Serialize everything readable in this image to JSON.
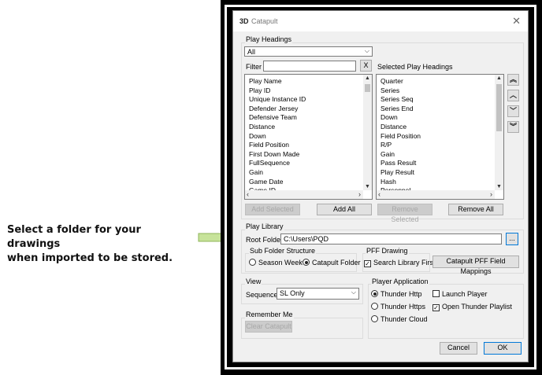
{
  "callout": {
    "line1": "Select a folder for your drawings",
    "line2": "when imported to be stored."
  },
  "dialog": {
    "title": "Catapult",
    "app_icon": "3D",
    "close_glyph": "✕"
  },
  "play_headings": {
    "group_label": "Play Headings",
    "combo_value": "All",
    "filter_label": "Filter",
    "filter_value": "",
    "filter_clear": "X",
    "selected_label": "Selected Play Headings",
    "available": [
      "Play Name",
      "Play ID",
      "Unique Instance ID",
      "Defender Jersey",
      "Defensive Team",
      "Distance",
      "Down",
      "Field Position",
      "First Down Made",
      "FullSequence",
      "Gain",
      "Game Date",
      "Game ID"
    ],
    "selected": [
      "Quarter",
      "Series",
      "Series Seq",
      "Series End",
      "Down",
      "Distance",
      "Field Position",
      "R/P",
      "Gain",
      "Pass Result",
      "Play Result",
      "Hash",
      "Personnel"
    ],
    "add_selected": "Add Selected",
    "add_all": "Add All",
    "remove_selected": "Remove Selected",
    "remove_all": "Remove All",
    "order_icons": [
      "double-up-icon",
      "up-icon",
      "down-icon",
      "double-down-icon"
    ]
  },
  "play_library": {
    "group_label": "Play Library",
    "root_folder_label": "Root Folder",
    "root_folder_value": "C:\\Users\\PQD",
    "browse_label": "...",
    "sub_folder": {
      "label": "Sub Folder Structure",
      "season_week": "Season Week",
      "catapult_folder": "Catapult Folder",
      "selected": "Catapult Folder"
    },
    "pff_drawing": {
      "label": "PFF Drawing",
      "search_library_first": "Search Library First",
      "search_library_first_checked": true,
      "mappings_button": "Catapult PFF Field Mappings"
    }
  },
  "view": {
    "group_label": "View",
    "sequence_label": "Sequence",
    "sequence_value": "SL Only"
  },
  "player_application": {
    "group_label": "Player Application",
    "thunder_http": "Thunder Http",
    "thunder_https": "Thunder Https",
    "thunder_cloud": "Thunder Cloud",
    "selected": "Thunder Http",
    "launch_player": "Launch Player",
    "launch_player_checked": false,
    "open_playlist": "Open Thunder Playlist",
    "open_playlist_checked": true
  },
  "remember_me": {
    "group_label": "Remember Me",
    "clear_button": "Clear Catapult"
  },
  "footer": {
    "cancel": "Cancel",
    "ok": "OK"
  },
  "colors": {
    "callout_arrow": "#c7e39a",
    "accent": "#0078d7"
  }
}
